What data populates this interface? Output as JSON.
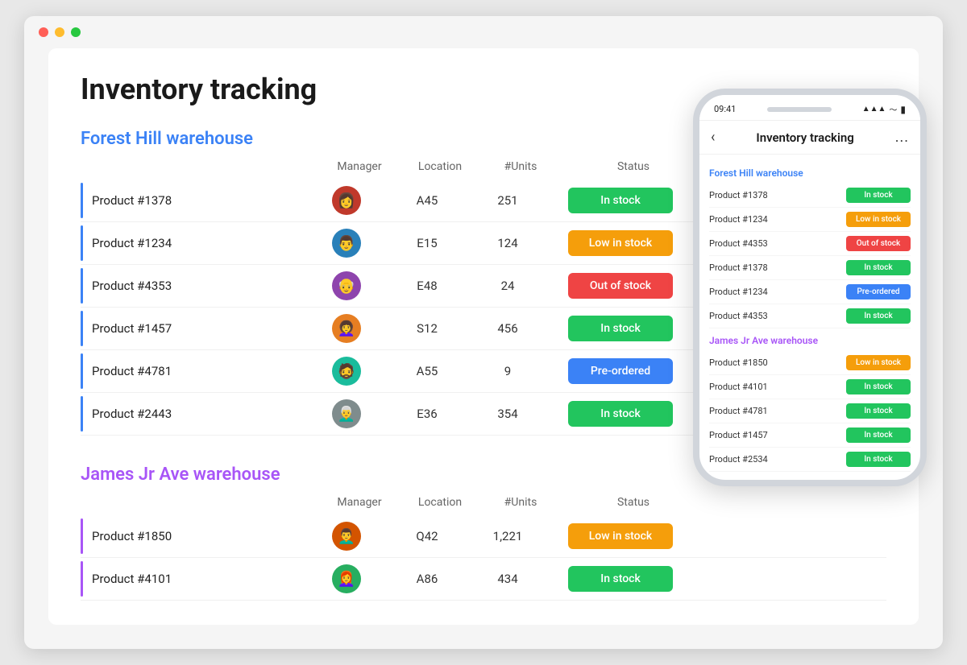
{
  "window": {
    "dots": [
      "red",
      "yellow",
      "green"
    ]
  },
  "page": {
    "title": "Inventory tracking",
    "warehouse1": {
      "name": "Forest Hill warehouse",
      "color": "blue",
      "columns": {
        "manager": "Manager",
        "location": "Location",
        "units": "#Units",
        "status": "Status"
      },
      "rows": [
        {
          "product": "Product  #1378",
          "location": "A45",
          "units": "251",
          "status": "In stock",
          "status_type": "green",
          "avatar": "👩"
        },
        {
          "product": "Product  #1234",
          "location": "E15",
          "units": "124",
          "status": "Low in stock",
          "status_type": "orange",
          "avatar": "👨"
        },
        {
          "product": "Product  #4353",
          "location": "E48",
          "units": "24",
          "status": "Out of stock",
          "status_type": "red",
          "avatar": "👴"
        },
        {
          "product": "Product  #1457",
          "location": "S12",
          "units": "456",
          "status": "In stock",
          "status_type": "green",
          "avatar": "👩‍🦱"
        },
        {
          "product": "Product  #4781",
          "location": "A55",
          "units": "9",
          "status": "Pre-ordered",
          "status_type": "blue",
          "avatar": "🧔"
        },
        {
          "product": "Product  #2443",
          "location": "E36",
          "units": "354",
          "status": "In stock",
          "status_type": "green",
          "avatar": "👨‍🦳"
        }
      ]
    },
    "warehouse2": {
      "name": "James Jr Ave warehouse",
      "color": "purple",
      "columns": {
        "manager": "Manager",
        "location": "Location",
        "units": "#Units",
        "status": "Status"
      },
      "rows": [
        {
          "product": "Product  #1850",
          "location": "Q42",
          "units": "1,221",
          "status": "Low in stock",
          "status_type": "orange",
          "avatar": "👨‍🦱"
        },
        {
          "product": "Product  #4101",
          "location": "A86",
          "units": "434",
          "status": "In stock",
          "status_type": "green",
          "avatar": "👩‍🦰"
        }
      ]
    }
  },
  "phone": {
    "time": "09:41",
    "title": "Inventory tracking",
    "back_icon": "‹",
    "more_icon": "...",
    "warehouse1": {
      "name": "Forest Hill warehouse",
      "rows": [
        {
          "product": "Product #1378",
          "status": "In stock",
          "type": "green"
        },
        {
          "product": "Product #1234",
          "status": "Low in stock",
          "type": "orange"
        },
        {
          "product": "Product #4353",
          "status": "Out of stock",
          "type": "red"
        },
        {
          "product": "Product #1378",
          "status": "In stock",
          "type": "green"
        },
        {
          "product": "Product #1234",
          "status": "Pre-ordered",
          "type": "blue"
        },
        {
          "product": "Product #4353",
          "status": "In stock",
          "type": "green"
        }
      ]
    },
    "warehouse2": {
      "name": "James Jr Ave warehouse",
      "rows": [
        {
          "product": "Product #1850",
          "status": "Low in stock",
          "type": "orange"
        },
        {
          "product": "Product #4101",
          "status": "In stock",
          "type": "green"
        },
        {
          "product": "Product #4781",
          "status": "In stock",
          "type": "green"
        },
        {
          "product": "Product #1457",
          "status": "In stock",
          "type": "green"
        },
        {
          "product": "Product #2534",
          "status": "In stock",
          "type": "green"
        }
      ]
    }
  }
}
